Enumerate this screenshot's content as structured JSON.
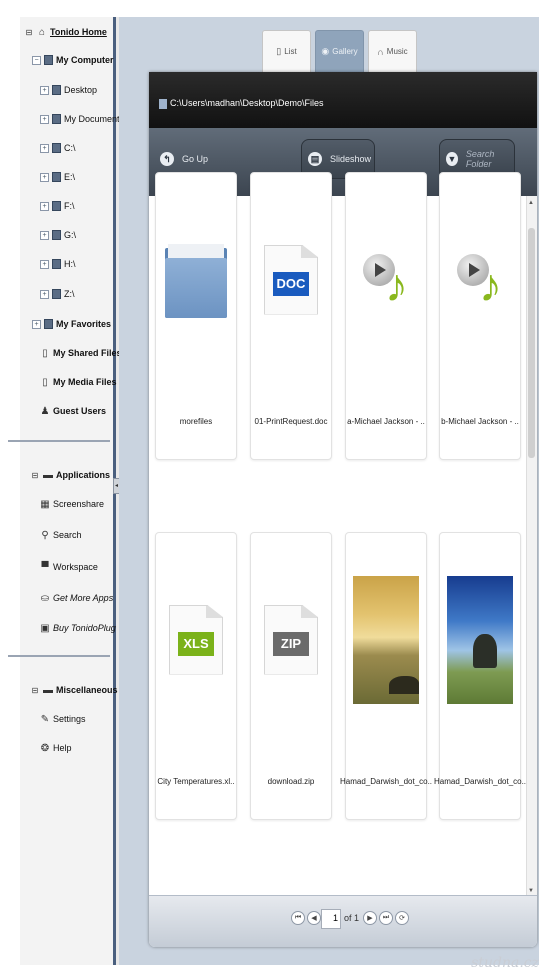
{
  "sidebar": {
    "home": "Tonido Home",
    "my_computer": "My Computer",
    "items": [
      "Desktop",
      "My Documents",
      "C:\\",
      "E:\\",
      "F:\\",
      "G:\\",
      "H:\\",
      "Z:\\"
    ],
    "favorites": "My Favorites",
    "shared": "My Shared Files",
    "media": "My Media Files",
    "guests": "Guest Users",
    "applications": "Applications",
    "apps": [
      "Screenshare",
      "Search",
      "Workspace",
      "Get More Apps",
      "Buy TonidoPlug"
    ],
    "misc": "Miscellaneous",
    "misc_items": [
      "Settings",
      "Help"
    ]
  },
  "tabs": [
    "List",
    "Gallery",
    "Music"
  ],
  "path": "C:\\Users\\madhan\\Desktop\\Demo\\Files",
  "toolbar": {
    "go_up": "Go Up",
    "slideshow": "Slideshow",
    "search_placeholder": "Search Folder"
  },
  "files": [
    {
      "name": "morefiles",
      "kind": "folder"
    },
    {
      "name": "01-PrintRequest.doc",
      "kind": "doc",
      "badge": "DOC",
      "color": "#1a5bbf"
    },
    {
      "name": "a-Michael Jackson - ..",
      "kind": "music"
    },
    {
      "name": "b-Michael Jackson - ..",
      "kind": "music"
    },
    {
      "name": "City Temperatures.xl..",
      "kind": "doc",
      "badge": "XLS",
      "color": "#7bb21a"
    },
    {
      "name": "download.zip",
      "kind": "doc",
      "badge": "ZIP",
      "color": "#6b6b6b"
    },
    {
      "name": "Hamad_Darwish_dot_co..",
      "kind": "photo1"
    },
    {
      "name": "Hamad_Darwish_dot_co..",
      "kind": "photo2"
    }
  ],
  "pager": {
    "page": "1",
    "of": "of 1"
  },
  "watermark": "studna.cz"
}
